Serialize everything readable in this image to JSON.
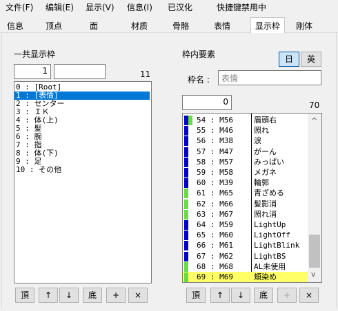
{
  "menu": [
    "文件(F)",
    "编辑(E)",
    "显示(V)",
    "信息(I)",
    "已汉化",
    "快捷键禁用中"
  ],
  "tabs": [
    "信息",
    "顶点",
    "面",
    "材质",
    "骨骼",
    "表情",
    "显示枠",
    "刚体"
  ],
  "left": {
    "title": "一共显示枠",
    "index_value": "1",
    "count": "11",
    "items": [
      "0 : [Root]",
      "1 : [表情]",
      "2 : センター",
      "3 : ＩＫ",
      "4 : 体(上)",
      "5 : 髪",
      "6 : 腕",
      "7 : 指",
      "8 : 体(下)",
      "9 : 足",
      "10 : その他"
    ],
    "selected_index": 1,
    "buttons": [
      "頂",
      "↑",
      "↓",
      "底",
      "+",
      "×"
    ]
  },
  "right": {
    "title": "枠内要素",
    "btn_jp": "日",
    "btn_en": "英",
    "name_label": "枠名 :",
    "name_value": "表情",
    "index_value": "0",
    "count": "70",
    "items": [
      {
        "num": "54 : M56",
        "name": "眉頭右",
        "c1": "#0000cc",
        "c2": "#66dd44"
      },
      {
        "num": "55 : M46",
        "name": "照れ",
        "c1": "#0000cc",
        "c2": ""
      },
      {
        "num": "56 : M38",
        "name": "涙",
        "c1": "#0000cc",
        "c2": ""
      },
      {
        "num": "57 : M47",
        "name": "がーん",
        "c1": "#0000cc",
        "c2": ""
      },
      {
        "num": "58 : M57",
        "name": "みっぱい",
        "c1": "#0000cc",
        "c2": ""
      },
      {
        "num": "59 : M58",
        "name": "メガネ",
        "c1": "#0000cc",
        "c2": ""
      },
      {
        "num": "60 : M39",
        "name": "輪郭",
        "c1": "#0000cc",
        "c2": ""
      },
      {
        "num": "61 : M65",
        "name": "青ざめる",
        "c1": "#66dd44",
        "c2": ""
      },
      {
        "num": "62 : M66",
        "name": "髪影消",
        "c1": "#66dd44",
        "c2": ""
      },
      {
        "num": "63 : M67",
        "name": "照れ消",
        "c1": "#66dd44",
        "c2": ""
      },
      {
        "num": "64 : M59",
        "name": "LightUp",
        "c1": "#0000cc",
        "c2": ""
      },
      {
        "num": "65 : M60",
        "name": "LightOff",
        "c1": "#0000cc",
        "c2": ""
      },
      {
        "num": "66 : M61",
        "name": "LightBlink",
        "c1": "#0000cc",
        "c2": ""
      },
      {
        "num": "67 : M62",
        "name": "LightBS",
        "c1": "#0000cc",
        "c2": ""
      },
      {
        "num": "68 : M68",
        "name": "AL未使用",
        "c1": "#66dd44",
        "c2": ""
      },
      {
        "num": "69 : M69",
        "name": "頬染め",
        "c1": "#66dd44",
        "c2": ""
      }
    ],
    "buttons": [
      "頂",
      "↑",
      "↓",
      "底",
      "+",
      "×"
    ]
  },
  "colors": {
    "selection": "#0078d7",
    "highlight": "#ffff66"
  }
}
